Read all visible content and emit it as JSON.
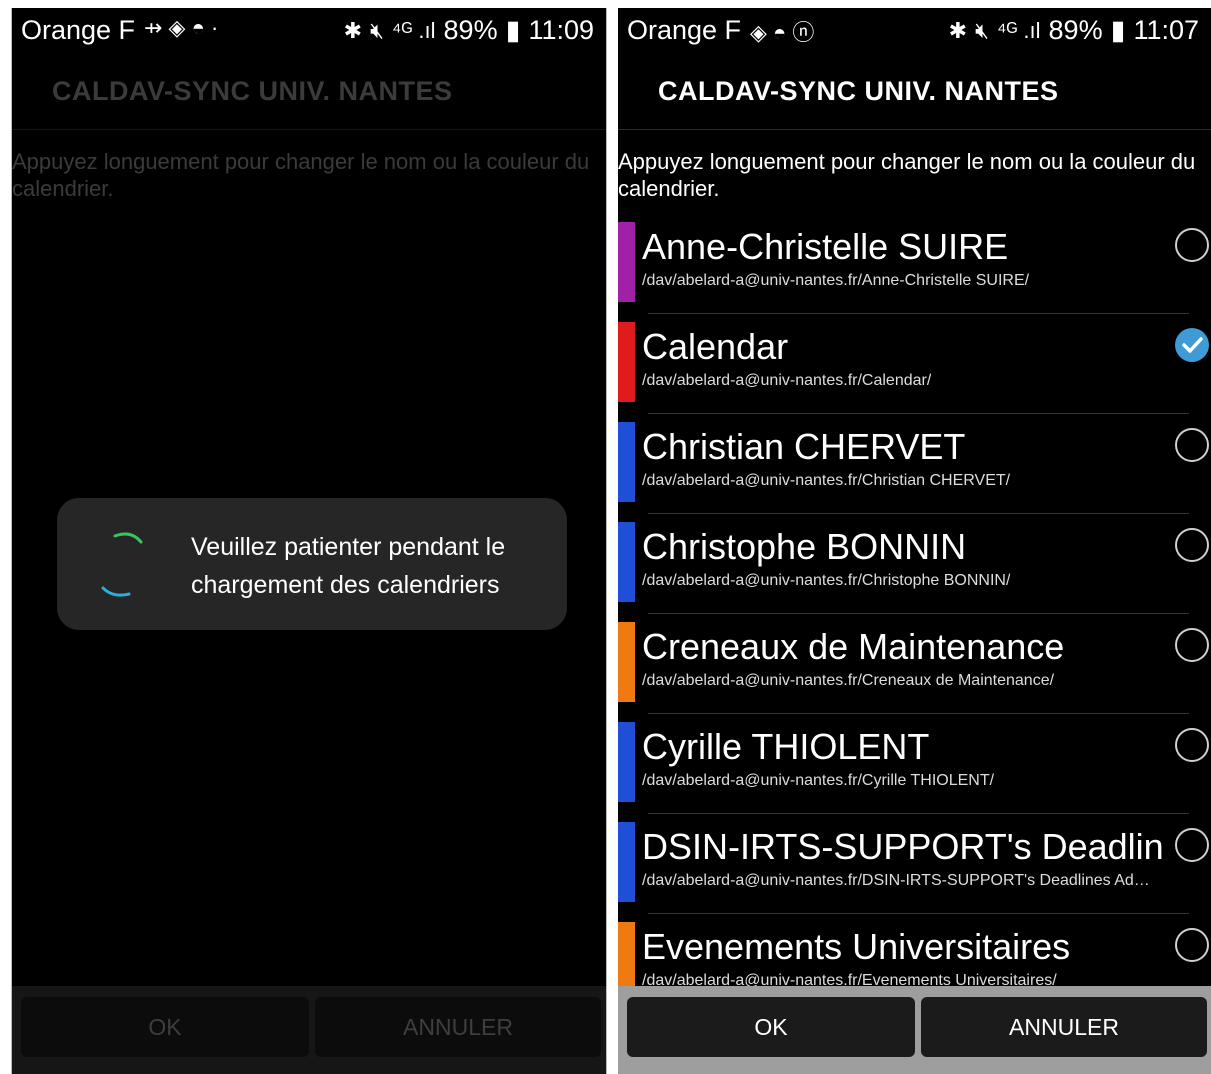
{
  "left": {
    "status": {
      "carrier": "Orange F",
      "icons": "⇸ ◈ ◓ ·",
      "net": "⁴ᴳ .ıl",
      "battery_pct": "89%",
      "time": "11:09"
    },
    "title": "CALDAV-SYNC UNIV. NANTES",
    "hint": "Appuyez longuement pour changer le nom ou la couleur du calendrier.",
    "dialog": {
      "text": "Veuillez patienter pendant le chargement des calendriers"
    },
    "buttons": {
      "ok": "OK",
      "cancel": "ANNULER"
    }
  },
  "right": {
    "status": {
      "carrier": "Orange F",
      "icons": "◈ ◓ ⓝ",
      "net": "⁴ᴳ .ıl",
      "battery_pct": "89%",
      "time": "11:07"
    },
    "title": "CALDAV-SYNC UNIV. NANTES",
    "hint": "Appuyez longuement pour changer le nom ou la couleur du calendrier.",
    "calendars": [
      {
        "name": "Anne-Christelle SUIRE",
        "path": "/dav/abelard-a@univ-nantes.fr/Anne-Christelle SUIRE/",
        "color": "#a020a8",
        "checked": false
      },
      {
        "name": "Calendar",
        "path": "/dav/abelard-a@univ-nantes.fr/Calendar/",
        "color": "#e01b1b",
        "checked": true
      },
      {
        "name": "Christian CHERVET",
        "path": "/dav/abelard-a@univ-nantes.fr/Christian CHERVET/",
        "color": "#1f4fd6",
        "checked": false
      },
      {
        "name": "Christophe BONNIN",
        "path": "/dav/abelard-a@univ-nantes.fr/Christophe BONNIN/",
        "color": "#1f4fd6",
        "checked": false
      },
      {
        "name": "Creneaux de Maintenance",
        "path": "/dav/abelard-a@univ-nantes.fr/Creneaux de Maintenance/",
        "color": "#ef7a12",
        "checked": false
      },
      {
        "name": "Cyrille THIOLENT",
        "path": "/dav/abelard-a@univ-nantes.fr/Cyrille THIOLENT/",
        "color": "#1f4fd6",
        "checked": false
      },
      {
        "name": "DSIN-IRTS-SUPPORT's Deadlin…",
        "path": "/dav/abelard-a@univ-nantes.fr/DSIN-IRTS-SUPPORT's Deadlines Ad…",
        "color": "#1f4fd6",
        "checked": false
      },
      {
        "name": "Evenements Universitaires",
        "path": "/dav/abelard-a@univ-nantes.fr/Evenements Universitaires/",
        "color": "#ef7a12",
        "checked": false
      }
    ],
    "buttons": {
      "ok": "OK",
      "cancel": "ANNULER"
    }
  }
}
